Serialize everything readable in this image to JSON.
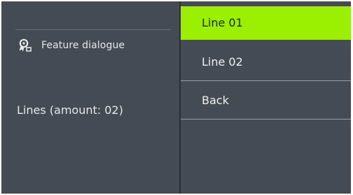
{
  "dialog": {
    "title": "Feature dialogue",
    "title_icon": "feature-settings-icon",
    "summary": "Lines (amount: 02)"
  },
  "menu": {
    "items": [
      {
        "label": "Line 01",
        "selected": true
      },
      {
        "label": "Line 02",
        "selected": false
      },
      {
        "label": "Back",
        "selected": false
      }
    ]
  },
  "colors": {
    "background": "#454b55",
    "accent": "#9af000",
    "text": "#e6e8eb",
    "separator": "#9aa0a8"
  }
}
